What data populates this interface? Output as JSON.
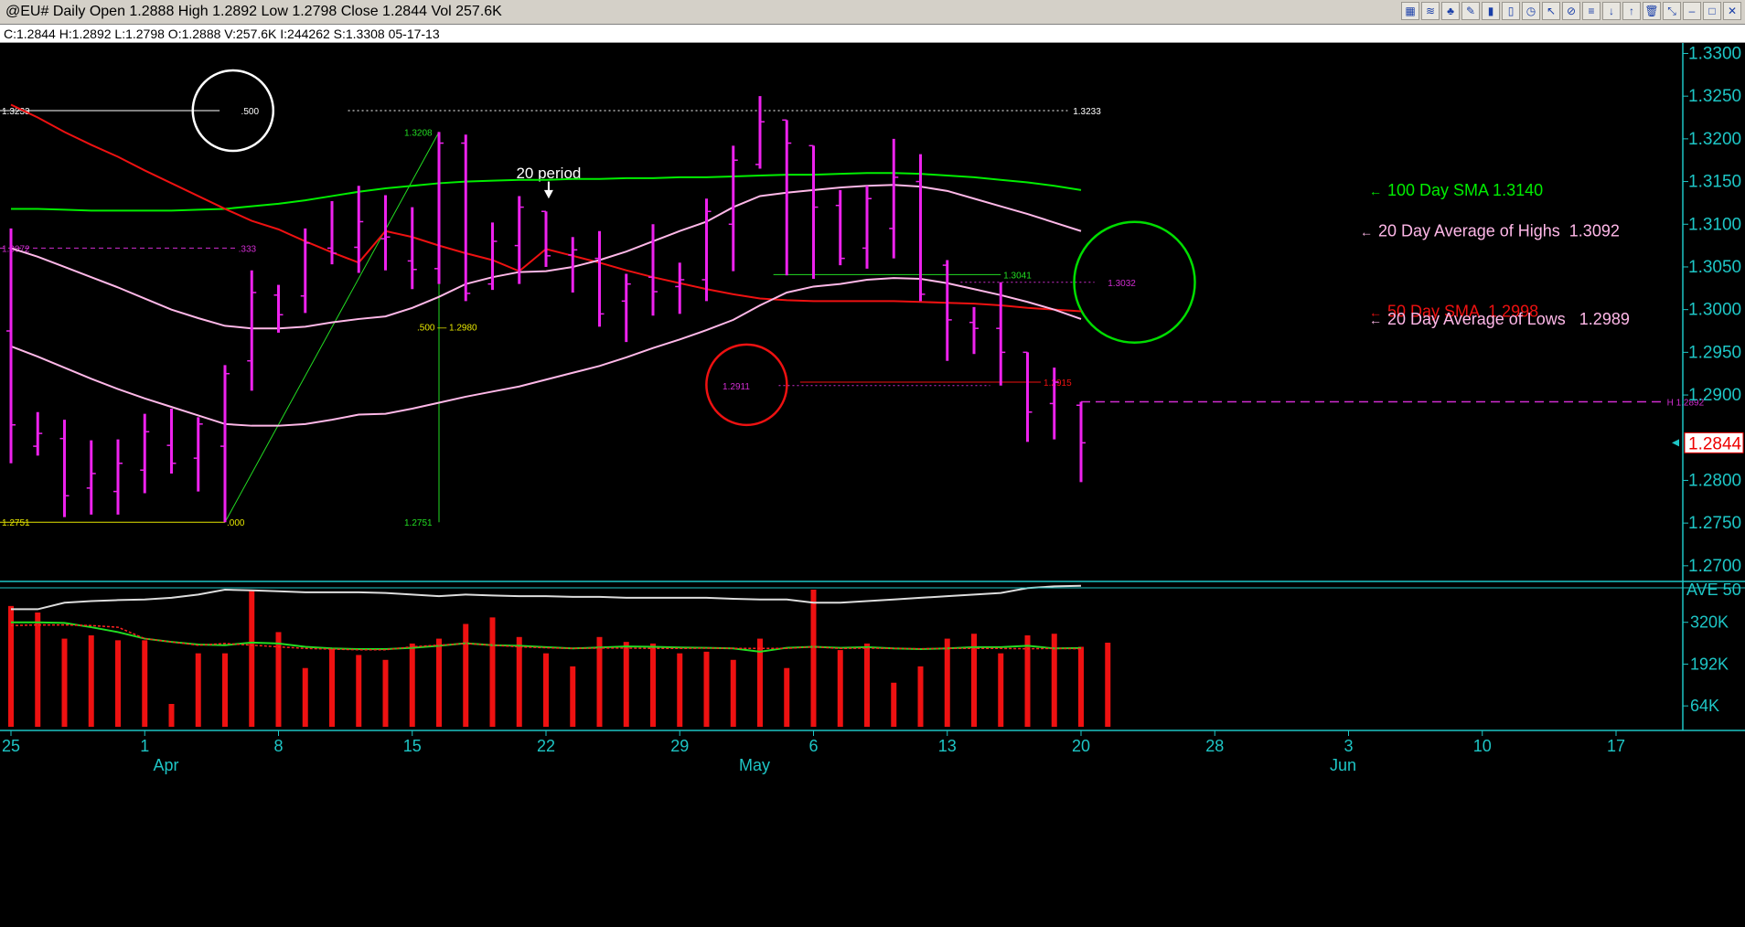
{
  "window": {
    "title": "@EU# Daily Open 1.2888 High 1.2892 Low 1.2798 Close 1.2844 Vol 257.6K",
    "info": "C:1.2844  H:1.2892  L:1.2798  O:1.2888  V:257.6K  I:244262  S:1.3308  05-17-13",
    "toolbar_icons": [
      "chart-icon",
      "line-icon",
      "tree-icon",
      "pencil-icon",
      "bars-icon",
      "candle-icon",
      "clock-icon",
      "cursor-icon",
      "fib-icon",
      "trend-icon",
      "arrow-down-icon",
      "arrow-up-icon",
      "trash-icon",
      "restore-icon",
      "minimize-icon",
      "maximize-icon",
      "close-icon"
    ],
    "toolbar_glyphs": [
      "▦",
      "≋",
      "♣",
      "✎",
      "▮",
      "▯",
      "◷",
      "↖",
      "⊘",
      "≡",
      "↓",
      "↑",
      "🗑",
      "⤡",
      "–",
      "□",
      "✕"
    ]
  },
  "chart_data": {
    "type": "ohlc",
    "symbol": "@EU#",
    "price_ylim": [
      1.2687,
      1.3308
    ],
    "price_ticks": [
      "1.3300",
      "1.3250",
      "1.3200",
      "1.3150",
      "1.3100",
      "1.3050",
      "1.3000",
      "1.2950",
      "1.2900",
      "1.2800",
      "1.2750",
      "1.2700"
    ],
    "last_price_label": "1.2844",
    "x_tick_labels": [
      {
        "label": "25",
        "slot": 0
      },
      {
        "label": "1",
        "slot": 5
      },
      {
        "label": "8",
        "slot": 10
      },
      {
        "label": "15",
        "slot": 15
      },
      {
        "label": "22",
        "slot": 20
      },
      {
        "label": "29",
        "slot": 25
      },
      {
        "label": "6",
        "slot": 30
      },
      {
        "label": "13",
        "slot": 35
      },
      {
        "label": "20",
        "slot": 40
      },
      {
        "label": "28",
        "slot": 45
      },
      {
        "label": "3",
        "slot": 50
      },
      {
        "label": "10",
        "slot": 55
      },
      {
        "label": "17",
        "slot": 60
      }
    ],
    "month_labels": [
      {
        "label": "Apr",
        "slot": 6
      },
      {
        "label": "May",
        "slot": 28
      },
      {
        "label": "Jun",
        "slot": 50
      }
    ],
    "bars": [
      {
        "o": 1.2975,
        "h": 1.3095,
        "l": 1.282,
        "c": 1.2865
      },
      {
        "o": 1.284,
        "h": 1.288,
        "l": 1.2829,
        "c": 1.2855
      },
      {
        "o": 1.2849,
        "h": 1.2871,
        "l": 1.2757,
        "c": 1.2782
      },
      {
        "o": 1.2791,
        "h": 1.2847,
        "l": 1.276,
        "c": 1.2808
      },
      {
        "o": 1.2787,
        "h": 1.2848,
        "l": 1.276,
        "c": 1.282
      },
      {
        "o": 1.2812,
        "h": 1.2878,
        "l": 1.2785,
        "c": 1.2857
      },
      {
        "o": 1.2841,
        "h": 1.2884,
        "l": 1.2808,
        "c": 1.282
      },
      {
        "o": 1.2826,
        "h": 1.2874,
        "l": 1.2787,
        "c": 1.2866
      },
      {
        "o": 1.284,
        "h": 1.2935,
        "l": 1.2751,
        "c": 1.2925
      },
      {
        "o": 1.294,
        "h": 1.3046,
        "l": 1.2905,
        "c": 1.302
      },
      {
        "o": 1.3017,
        "h": 1.3029,
        "l": 1.2973,
        "c": 1.2994
      },
      {
        "o": 1.3016,
        "h": 1.3095,
        "l": 1.2996,
        "c": 1.3078
      },
      {
        "o": 1.3072,
        "h": 1.3127,
        "l": 1.3053,
        "c": 1.3066
      },
      {
        "o": 1.3073,
        "h": 1.3145,
        "l": 1.3043,
        "c": 1.3103
      },
      {
        "o": 1.3083,
        "h": 1.3134,
        "l": 1.3046,
        "c": 1.3085
      },
      {
        "o": 1.3057,
        "h": 1.312,
        "l": 1.3024,
        "c": 1.3047
      },
      {
        "o": 1.3048,
        "h": 1.3208,
        "l": 1.303,
        "c": 1.3195
      },
      {
        "o": 1.3195,
        "h": 1.3205,
        "l": 1.301,
        "c": 1.3019
      },
      {
        "o": 1.303,
        "h": 1.3102,
        "l": 1.3023,
        "c": 1.308
      },
      {
        "o": 1.3075,
        "h": 1.3133,
        "l": 1.303,
        "c": 1.312
      },
      {
        "o": 1.3115,
        "h": 1.3101,
        "l": 1.305,
        "c": 1.3063
      },
      {
        "o": 1.3064,
        "h": 1.3085,
        "l": 1.302,
        "c": 1.307
      },
      {
        "o": 1.306,
        "h": 1.3092,
        "l": 1.298,
        "c": 1.2995
      },
      {
        "o": 1.301,
        "h": 1.3042,
        "l": 1.2962,
        "c": 1.303
      },
      {
        "o": 1.3038,
        "h": 1.31,
        "l": 1.2993,
        "c": 1.3021
      },
      {
        "o": 1.3027,
        "h": 1.3055,
        "l": 1.2995,
        "c": 1.3035
      },
      {
        "o": 1.3035,
        "h": 1.313,
        "l": 1.301,
        "c": 1.3115
      },
      {
        "o": 1.31,
        "h": 1.3192,
        "l": 1.3045,
        "c": 1.3175
      },
      {
        "o": 1.317,
        "h": 1.325,
        "l": 1.3165,
        "c": 1.322
      },
      {
        "o": 1.3222,
        "h": 1.3222,
        "l": 1.304,
        "c": 1.3195
      },
      {
        "o": 1.3192,
        "h": 1.3165,
        "l": 1.3036,
        "c": 1.312
      },
      {
        "o": 1.3122,
        "h": 1.314,
        "l": 1.3052,
        "c": 1.306
      },
      {
        "o": 1.3072,
        "h": 1.3145,
        "l": 1.3048,
        "c": 1.313
      },
      {
        "o": 1.3095,
        "h": 1.32,
        "l": 1.306,
        "c": 1.3155
      },
      {
        "o": 1.315,
        "h": 1.3182,
        "l": 1.301,
        "c": 1.3018
      },
      {
        "o": 1.3052,
        "h": 1.3058,
        "l": 1.294,
        "c": 1.2988
      },
      {
        "o": 1.2985,
        "h": 1.3003,
        "l": 1.2948,
        "c": 1.2978
      },
      {
        "o": 1.2978,
        "h": 1.3032,
        "l": 1.2911,
        "c": 1.295
      },
      {
        "o": 1.295,
        "h": 1.2945,
        "l": 1.2845,
        "c": 1.288
      },
      {
        "o": 1.289,
        "h": 1.2932,
        "l": 1.2848,
        "c": 1.2915
      },
      {
        "o": 1.2888,
        "h": 1.2892,
        "l": 1.2798,
        "c": 1.2844
      }
    ],
    "series": [
      {
        "name": "100 Day SMA",
        "color": "#00ee00",
        "values": [
          1.3118,
          1.3118,
          1.3117,
          1.3116,
          1.3116,
          1.3116,
          1.3116,
          1.3117,
          1.3118,
          1.3121,
          1.3124,
          1.3128,
          1.3133,
          1.3138,
          1.3142,
          1.3145,
          1.3148,
          1.315,
          1.3151,
          1.3152,
          1.3152,
          1.3153,
          1.3153,
          1.3154,
          1.3154,
          1.3155,
          1.3155,
          1.3156,
          1.3157,
          1.3158,
          1.3158,
          1.3159,
          1.316,
          1.316,
          1.3159,
          1.3157,
          1.3155,
          1.3152,
          1.3149,
          1.3145,
          1.314
        ]
      },
      {
        "name": "50 Day SMA",
        "color": "#ee1111",
        "values": [
          1.324,
          1.3225,
          1.3208,
          1.3193,
          1.3179,
          1.3163,
          1.3148,
          1.3133,
          1.3118,
          1.3104,
          1.3094,
          1.308,
          1.3067,
          1.3055,
          1.3092,
          1.3085,
          1.3075,
          1.3066,
          1.3058,
          1.3045,
          1.3071,
          1.3063,
          1.3055,
          1.3046,
          1.3038,
          1.3031,
          1.3024,
          1.3018,
          1.3013,
          1.3011,
          1.301,
          1.301,
          1.301,
          1.301,
          1.3009,
          1.3008,
          1.3007,
          1.3005,
          1.3002,
          1.3,
          1.2998
        ]
      },
      {
        "name": "20 Day Average of Highs",
        "color": "#ffb8e8",
        "values": [
          1.3072,
          1.3062,
          1.305,
          1.3038,
          1.3026,
          1.3013,
          1.3,
          1.299,
          1.2981,
          1.2978,
          1.2978,
          1.298,
          1.2985,
          1.2989,
          1.2992,
          1.3002,
          1.3015,
          1.303,
          1.3038,
          1.3044,
          1.3045,
          1.305,
          1.3058,
          1.3068,
          1.308,
          1.3092,
          1.3103,
          1.312,
          1.3133,
          1.3137,
          1.314,
          1.3143,
          1.3145,
          1.3146,
          1.3144,
          1.3139,
          1.313,
          1.3121,
          1.3112,
          1.3102,
          1.3092
        ]
      },
      {
        "name": "20 Day Average of Lows",
        "color": "#ffb8e8",
        "values": [
          1.2957,
          1.2945,
          1.2932,
          1.2919,
          1.2907,
          1.2896,
          1.2886,
          1.2876,
          1.2866,
          1.2864,
          1.2864,
          1.2866,
          1.2871,
          1.2877,
          1.2878,
          1.2884,
          1.2891,
          1.2898,
          1.2904,
          1.291,
          1.2918,
          1.2926,
          1.2934,
          1.2944,
          1.2955,
          1.2965,
          1.2976,
          1.2988,
          1.3005,
          1.302,
          1.3027,
          1.303,
          1.3035,
          1.3037,
          1.3036,
          1.3031,
          1.3024,
          1.3017,
          1.3009,
          1.3,
          1.2989
        ]
      }
    ],
    "legend": [
      {
        "text": "100 Day SMA 1.3140",
        "color": "#00ee00",
        "value": 1.314
      },
      {
        "text": "20 Day Average of Highs  1.3092",
        "color": "#ffb8e8",
        "value": 1.3092
      },
      {
        "text": "50 Day SMA  1.2998",
        "color": "#ee1111",
        "value": 1.2998
      },
      {
        "text": "20 Day Average of Lows   1.2989",
        "color": "#ffb8e8",
        "value": 1.2989
      }
    ],
    "annotations": {
      "text_20_period": "20 period",
      "fib_retracement": {
        "start_slot": 8,
        "end_slot": 16,
        "low": 1.2751,
        "high": 1.3208,
        "low_label": "1.2751",
        "high_label": "1.3208",
        "mid_level": 1.298,
        "mid_label": ".500 — 1.2980",
        "low_left_label": "1.2751",
        "zero_label": ".000"
      },
      "level_1_3233": {
        "value": 1.3233,
        "left_label": "1.3233",
        "mid_label": ".500",
        "right_label": "1.3233"
      },
      "level_1_3072": {
        "value": 1.3072,
        "left_label": "1.3072",
        "mid_label": ".333"
      },
      "level_1_3041": {
        "value": 1.3041,
        "label": "1.3041"
      },
      "level_1_3032": {
        "value": 1.3032,
        "label": "1.3032"
      },
      "level_1_2911": {
        "value": 1.2911,
        "label": "1.2911"
      },
      "level_1_2915": {
        "value": 1.2915,
        "label": "1.2915"
      },
      "level_h_1_2892": {
        "value": 1.2892,
        "label": "H 1.2892"
      },
      "circles": [
        {
          "color": "#ffffff",
          "slot": 8.3,
          "value": 1.3233,
          "label": ".500"
        },
        {
          "color": "#ee1111",
          "slot": 27.5,
          "value": 1.2912,
          "label": "1.2911"
        },
        {
          "color": "#00dd00",
          "slot": 42,
          "value": 1.3032,
          "label": "1.3032"
        }
      ]
    },
    "volume": {
      "ylim": [
        0,
        420000
      ],
      "ticks": [
        {
          "label": "320K",
          "value": 320000
        },
        {
          "label": "192K",
          "value": 192000
        },
        {
          "label": "64K",
          "value": 64000
        }
      ],
      "header_label": "AVE  50",
      "values": [
        370000,
        350000,
        270000,
        280000,
        265000,
        265000,
        70000,
        225000,
        225000,
        420000,
        290000,
        180000,
        240000,
        220000,
        205000,
        255000,
        270000,
        315000,
        335000,
        275000,
        225000,
        185000,
        275000,
        260000,
        255000,
        225000,
        230000,
        205000,
        270000,
        180000,
        420000,
        235000,
        255000,
        135000,
        185000,
        270000,
        285000,
        225000,
        280000,
        285000,
        245000,
        257600
      ],
      "series": [
        {
          "name": "avg-white",
          "color": "#dddddd",
          "values": [
            360000,
            360000,
            380000,
            385000,
            388000,
            390000,
            395000,
            405000,
            420000,
            418000,
            415000,
            412000,
            412000,
            412000,
            410000,
            405000,
            400000,
            405000,
            402000,
            400000,
            400000,
            398000,
            398000,
            395000,
            395000,
            395000,
            395000,
            392000,
            390000,
            390000,
            380000,
            380000,
            385000,
            390000,
            395000,
            400000,
            405000,
            410000,
            425000,
            430000,
            432000
          ]
        },
        {
          "name": "avg-green",
          "color": "#22dd22",
          "values": [
            320000,
            320000,
            318000,
            305000,
            290000,
            270000,
            260000,
            252000,
            250000,
            258000,
            255000,
            245000,
            240000,
            238000,
            238000,
            242000,
            248000,
            256000,
            250000,
            248000,
            244000,
            240000,
            243000,
            246000,
            245000,
            243000,
            242000,
            240000,
            230000,
            242000,
            245000,
            242000,
            244000,
            240000,
            238000,
            240000,
            244000,
            244000,
            248000,
            240000,
            241000
          ]
        },
        {
          "name": "avg-red",
          "color": "#ff2222",
          "values": [
            310000,
            312000,
            312000,
            310000,
            305000,
            270000,
            260000,
            250000,
            255000,
            250000,
            245000,
            240000,
            238000,
            236000,
            236000,
            245000,
            250000,
            255000,
            250000,
            245000,
            242000,
            240000,
            241000,
            241000,
            240000,
            240000,
            241000,
            240000,
            240000,
            240000,
            245000,
            240000,
            241000,
            240000,
            239000,
            240000,
            240000,
            240000,
            239000,
            240000,
            239000
          ]
        }
      ]
    }
  }
}
